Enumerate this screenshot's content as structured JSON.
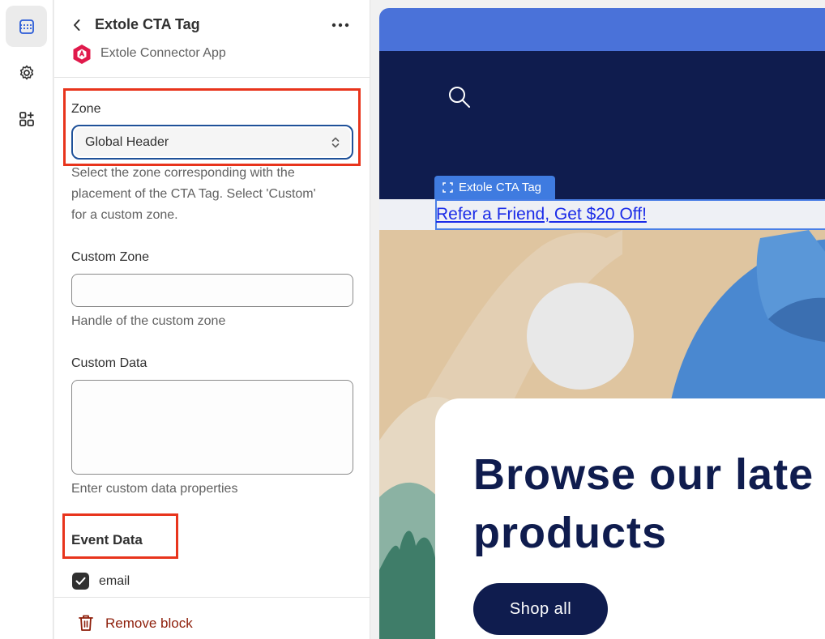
{
  "panel": {
    "title": "Extole CTA Tag",
    "app_name": "Extole Connector App"
  },
  "fields": {
    "zone": {
      "label": "Zone",
      "value": "Global Header",
      "help_lines": [
        "Select the zone corresponding with the",
        "placement of the CTA Tag. Select 'Custom'",
        "for a custom zone."
      ]
    },
    "custom_zone": {
      "label": "Custom Zone",
      "value": "",
      "help": "Handle of the custom zone"
    },
    "custom_data": {
      "label": "Custom Data",
      "value": "",
      "help": "Enter custom data properties"
    },
    "event_data": {
      "heading": "Event Data",
      "items": [
        {
          "label": "email",
          "checked": true
        }
      ]
    }
  },
  "footer": {
    "remove_label": "Remove block"
  },
  "preview": {
    "cta_tag_label": "Extole CTA Tag",
    "cta_link": "Refer a Friend, Get $20 Off!",
    "hero_heading_lines": [
      "Browse our late",
      "products"
    ],
    "shop_button": "Shop all"
  },
  "colors": {
    "highlight": "#e8341c",
    "select_focus": "#1f5199",
    "announcement_bar": "#4a72d9",
    "header_navy": "#0f1c4e",
    "cta_tag_blue": "#3f7be0",
    "remove_red": "#8e1f0b"
  },
  "icons": {
    "rail": [
      "sections-icon",
      "gear-icon",
      "apps-add-icon"
    ],
    "header": [
      "chevron-left-icon",
      "more-horizontal-icon"
    ],
    "preview": [
      "search-icon"
    ]
  }
}
